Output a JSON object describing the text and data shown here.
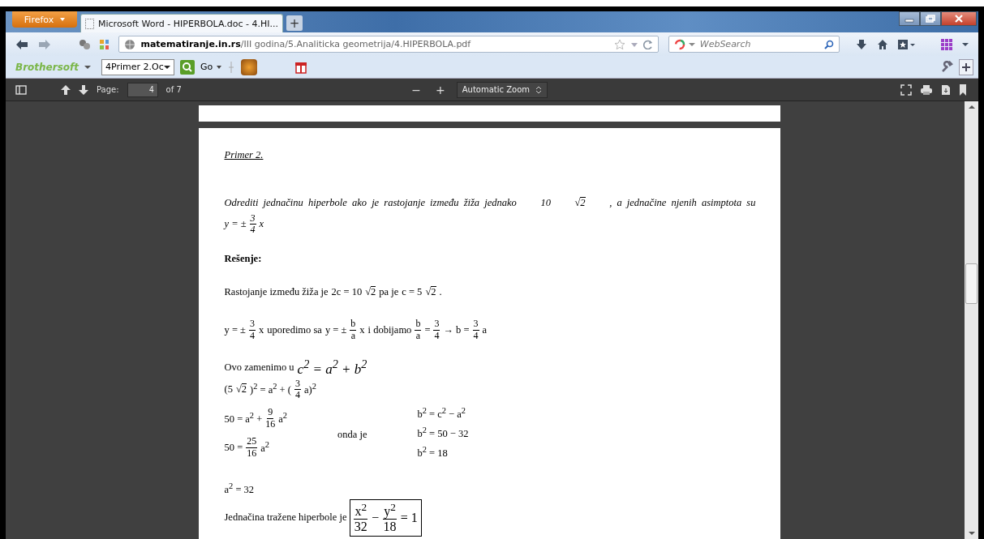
{
  "browser": {
    "menu_button": "Firefox",
    "tabs": [
      {
        "title": "Microsoft Word - HIPERBOLA.doc - 4.HI...",
        "selected": true
      }
    ],
    "new_tab": "+",
    "address": {
      "domain": "matematiranje.in.rs",
      "path": "/III godina/5.Analiticka geometrija/4.HIPERBOLA.pdf"
    },
    "search": {
      "placeholder": "WebSearch"
    },
    "bookmarks_bar": {
      "logo": "Brothersoft",
      "dropdown": "4Primer 2.Oc",
      "go": "Go"
    }
  },
  "pdf_toolbar": {
    "page_label": "Page:",
    "page_value": "4",
    "page_count": "of 7",
    "zoom_out": "−",
    "zoom_in": "+",
    "zoom": "Automatic Zoom"
  },
  "document": {
    "heading": "Primer 2.",
    "blocks": [
      {
        "kind": "para",
        "italic": true,
        "lines": [
          [
            {
              "kind": "text",
              "text": "Odrediti jednačinu hiperbole ako je rastojanje između žiža jednako"
            },
            {
              "kind": "math",
              "text": "10"
            },
            {
              "kind": "sqrt",
              "radical": "√",
              "radicand": "2"
            },
            {
              "kind": "text",
              "text": ", a jednačine njenih asimptota su"
            }
          ],
          [
            {
              "kind": "math",
              "text": "y = ±"
            },
            {
              "kind": "frac",
              "num": "3",
              "den": "4"
            },
            {
              "kind": "math",
              "text": "x"
            }
          ]
        ]
      },
      {
        "kind": "heading",
        "text": "Rešenje:"
      },
      {
        "kind": "para",
        "italic": false,
        "lines": [
          [
            {
              "kind": "text",
              "text": "Rastojanje između žiža je"
            },
            {
              "kind": "math",
              "text": "2c = 10"
            },
            {
              "kind": "sqrt",
              "radical": "√",
              "radicand": "2"
            },
            {
              "kind": "text",
              "text": "pa je"
            },
            {
              "kind": "math",
              "text": "c = 5"
            },
            {
              "kind": "sqrt",
              "radical": "√",
              "radicand": "2"
            },
            {
              "kind": "text",
              "text": "."
            }
          ]
        ]
      },
      {
        "kind": "para",
        "italic": false,
        "lines": [
          [
            {
              "kind": "math",
              "text": "y = ±"
            },
            {
              "kind": "frac",
              "num": "3",
              "den": "4"
            },
            {
              "kind": "math",
              "text": "x"
            },
            {
              "kind": "text",
              "text": "uporedimo sa"
            },
            {
              "kind": "math",
              "text": "y = ±"
            },
            {
              "kind": "frac",
              "num": "b",
              "den": "a"
            },
            {
              "kind": "math",
              "text": "x"
            },
            {
              "kind": "text",
              "text": "i dobijamo"
            },
            {
              "kind": "frac",
              "num": "b",
              "den": "a"
            },
            {
              "kind": "math",
              "text": "="
            },
            {
              "kind": "frac",
              "num": "3",
              "den": "4"
            },
            {
              "kind": "math",
              "text": "→ b ="
            },
            {
              "kind": "frac",
              "num": "3",
              "den": "4"
            },
            {
              "kind": "math",
              "text": "a"
            }
          ]
        ]
      },
      {
        "kind": "para",
        "italic": false,
        "lines": [
          [
            {
              "kind": "text",
              "text": "Ovo zamenimo u"
            },
            {
              "kind": "bigmath",
              "text": "c$^{2}$ = a$^{2}$ + b$^{2}$"
            }
          ],
          [
            {
              "kind": "math",
              "text": "(5"
            },
            {
              "kind": "sqrt",
              "radical": "√",
              "radicand": "2"
            },
            {
              "kind": "math",
              "text": ")$^{2}$ = a$^{2}$ + ("
            },
            {
              "kind": "frac",
              "num": "3",
              "den": "4"
            },
            {
              "kind": "math",
              "text": "a)$^{2}$"
            }
          ]
        ]
      },
      {
        "kind": "columns",
        "columns": [
          [
            [
              {
                "kind": "math",
                "text": "50 = a$^{2}$ +"
              },
              {
                "kind": "frac",
                "num": "9",
                "den": "16"
              },
              {
                "kind": "math",
                "text": "a$^{2}$"
              }
            ],
            [
              {
                "kind": "math",
                "text": "50 ="
              },
              {
                "kind": "frac",
                "num": "25",
                "den": "16"
              },
              {
                "kind": "math",
                "text": "a$^{2}$"
              }
            ]
          ],
          [
            [
              {
                "kind": "text",
                "text": "onda je"
              }
            ]
          ],
          [
            [
              {
                "kind": "math",
                "text": "b$^{2}$ = c$^{2}$ − a$^{2}$"
              }
            ],
            [
              {
                "kind": "math",
                "text": "b$^{2}$ = 50 − 32"
              }
            ],
            [
              {
                "kind": "math",
                "text": "b$^{2}$ = 18"
              }
            ]
          ]
        ]
      },
      {
        "kind": "para",
        "italic": false,
        "lines": [
          [
            {
              "kind": "math",
              "text": "a$^{2}$ = 32"
            }
          ],
          [
            {
              "kind": "text",
              "text": "Jednačina tražene hiperbole je"
            },
            {
              "kind": "box",
              "parts": [
                {
                  "kind": "frac",
                  "num": "x$^{2}$",
                  "den": "32"
                },
                {
                  "kind": "math",
                  "text": "−"
                },
                {
                  "kind": "frac",
                  "num": "y$^{2}$",
                  "den": "18"
                },
                {
                  "kind": "math",
                  "text": "= 1"
                }
              ]
            }
          ]
        ]
      }
    ]
  }
}
